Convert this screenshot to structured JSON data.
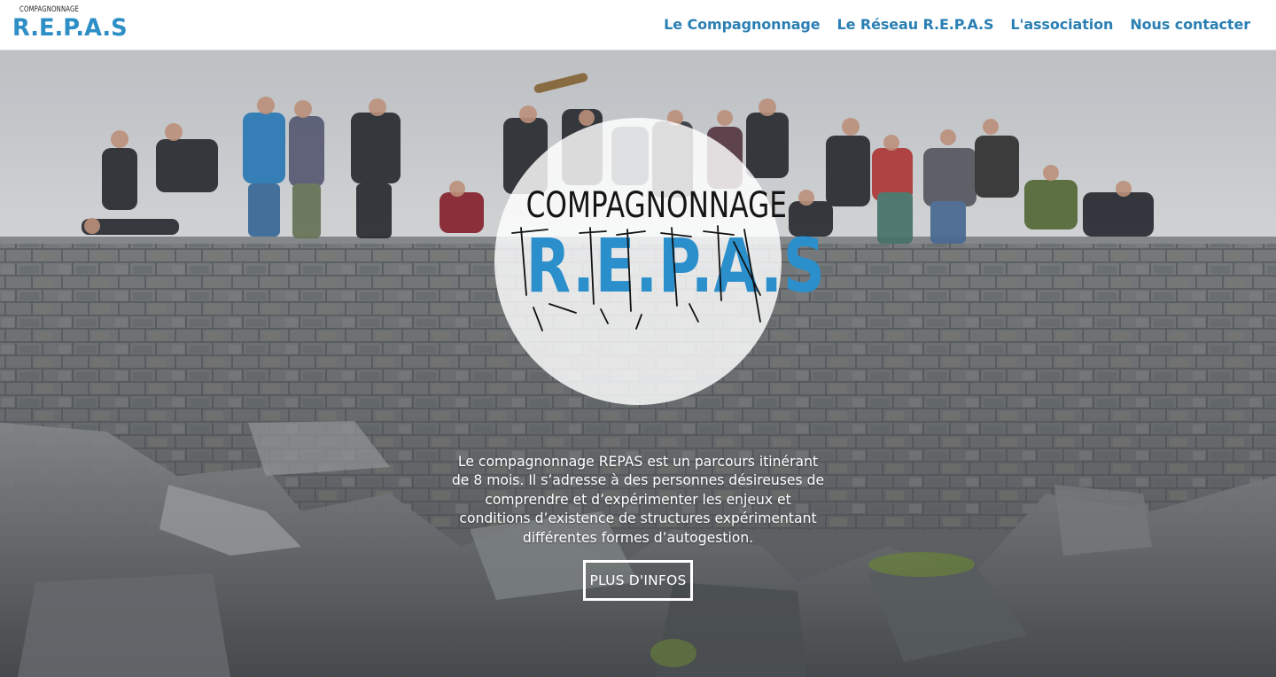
{
  "header": {
    "logo": {
      "small_text": "COMPAGNONNAGE",
      "big_text": "R.E.P.A.S"
    },
    "nav": [
      {
        "label": "Le Compagnonnage"
      },
      {
        "label": "Le Réseau R.E.P.A.S"
      },
      {
        "label": "L'association"
      },
      {
        "label": "Nous contacter"
      }
    ]
  },
  "hero": {
    "emblem": {
      "small_text": "COMPAGNONNAGE",
      "big_text": "R.E.P.A.S"
    },
    "intro": "Le compagnonnage REPAS est un parcours itinérant de 8 mois. Il s’adresse à des personnes désireuses de comprendre et d’expérimenter les enjeux et conditions d’existence de structures expérimentant différentes formes d’autogestion.",
    "cta_label": "PLUS D'INFOS"
  },
  "colors": {
    "brand_blue": "#2b8fcb",
    "nav_link": "#2a7fb4",
    "header_bg": "#ffffff",
    "sky": "#d6d9dc",
    "stone": "#6f7376"
  }
}
